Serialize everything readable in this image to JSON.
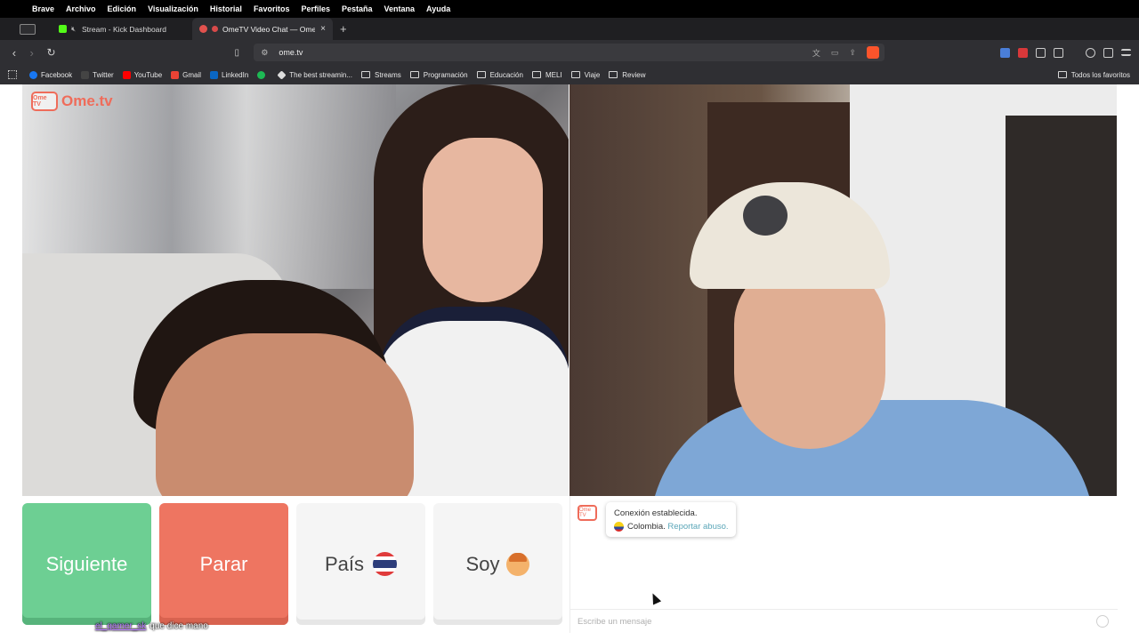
{
  "menubar": {
    "apple": "",
    "items": [
      "Brave",
      "Archivo",
      "Edición",
      "Visualización",
      "Historial",
      "Favoritos",
      "Perfiles",
      "Pestaña",
      "Ventana",
      "Ayuda"
    ]
  },
  "tabs": [
    {
      "title": "Stream - Kick Dashboard",
      "favicon": "kick-icon"
    },
    {
      "title": "OmeTV Video Chat — Omeg",
      "favicon": "ometv-icon"
    }
  ],
  "toolbar": {
    "url": "ome.tv"
  },
  "bookmarks": [
    {
      "label": "Facebook",
      "color": "#1877f2"
    },
    {
      "label": "Twitter",
      "color": "#222222"
    },
    {
      "label": "YouTube",
      "color": "#ff0000"
    },
    {
      "label": "Gmail",
      "color": "#ea4335"
    },
    {
      "label": "LinkedIn",
      "color": "#0a66c2"
    },
    {
      "label": "",
      "color": "#1db954"
    },
    {
      "label": "The best streamin...",
      "color": "#dddddd"
    }
  ],
  "bookmark_folders": [
    "Streams",
    "Programación",
    "Educación",
    "MELI",
    "Viaje",
    "Review"
  ],
  "bookmarks_all": "Todos los favoritos",
  "watermark": {
    "logo_text": "Ome TV",
    "brand": "Ome.tv"
  },
  "buttons": {
    "next": "Siguiente",
    "stop": "Parar",
    "country": "País",
    "gender": "Soy"
  },
  "stream_overlay": {
    "username": "el_gamer_sk",
    "message": "que dice mano"
  },
  "chat": {
    "system_icon_text": "Ome TV",
    "connected": "Conexión establecida.",
    "country": "Colombia.",
    "report": "Reportar abuso.",
    "placeholder": "Escribe un mensaje"
  }
}
